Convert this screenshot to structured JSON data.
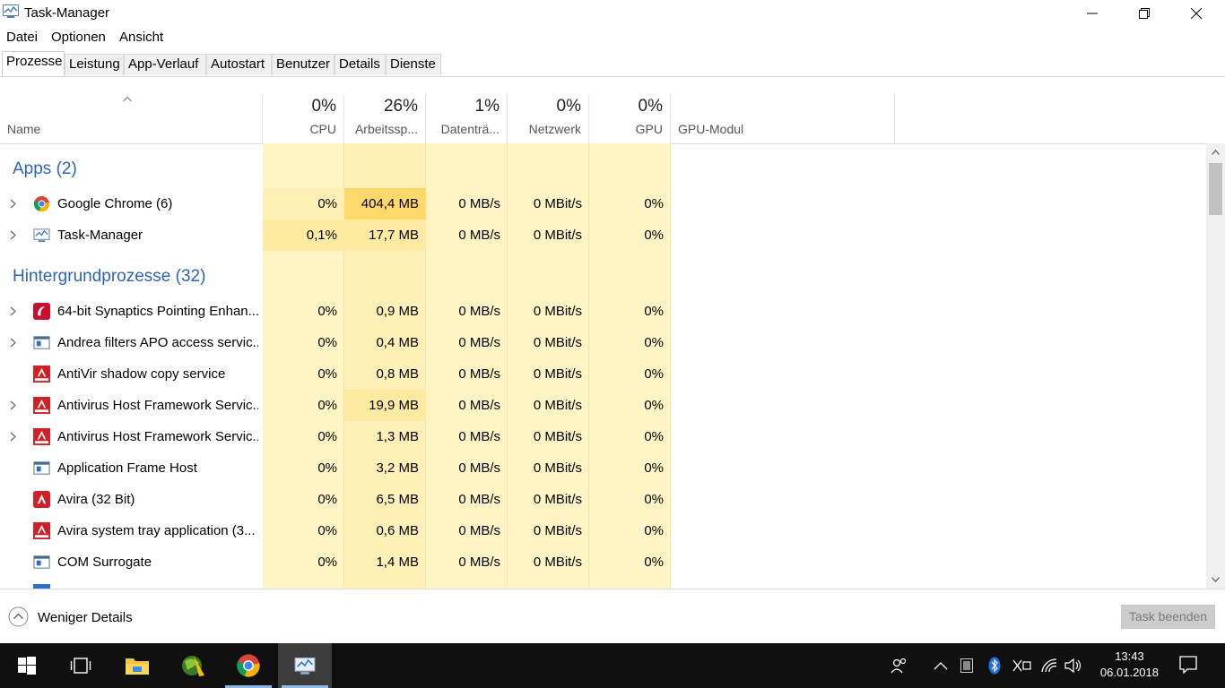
{
  "window": {
    "title": "Task-Manager"
  },
  "menu": [
    "Datei",
    "Optionen",
    "Ansicht"
  ],
  "tabs": [
    "Prozesse",
    "Leistung",
    "App-Verlauf",
    "Autostart",
    "Benutzer",
    "Details",
    "Dienste"
  ],
  "active_tab": "Prozesse",
  "columns": {
    "name": "Name",
    "cpu": {
      "pct": "0%",
      "label": "CPU"
    },
    "mem": {
      "pct": "26%",
      "label": "Arbeitssp..."
    },
    "disk": {
      "pct": "1%",
      "label": "Datenträ..."
    },
    "net": {
      "pct": "0%",
      "label": "Netzwerk"
    },
    "gpu": {
      "pct": "0%",
      "label": "GPU"
    },
    "gpu_engine": {
      "label": "GPU-Modul"
    }
  },
  "groups": {
    "apps": "Apps (2)",
    "background": "Hintergrundprozesse (32)"
  },
  "apps": [
    {
      "name": "Google Chrome (6)",
      "icon": "chrome-icon",
      "expandable": true,
      "cpu": "0%",
      "mem": "404,4 MB",
      "disk": "0 MB/s",
      "net": "0 MBit/s",
      "gpu": "0%"
    },
    {
      "name": "Task-Manager",
      "icon": "task-manager-icon",
      "expandable": true,
      "cpu": "0,1%",
      "mem": "17,7 MB",
      "disk": "0 MB/s",
      "net": "0 MBit/s",
      "gpu": "0%"
    }
  ],
  "background": [
    {
      "name": "64-bit Synaptics Pointing Enhan...",
      "icon": "synaptics-icon",
      "expandable": true,
      "cpu": "0%",
      "mem": "0,9 MB",
      "disk": "0 MB/s",
      "net": "0 MBit/s",
      "gpu": "0%"
    },
    {
      "name": "Andrea filters APO access servic...",
      "icon": "service-window-icon",
      "expandable": true,
      "cpu": "0%",
      "mem": "0,4 MB",
      "disk": "0 MB/s",
      "net": "0 MBit/s",
      "gpu": "0%"
    },
    {
      "name": "AntiVir shadow copy service",
      "icon": "avira-icon",
      "expandable": false,
      "cpu": "0%",
      "mem": "0,8 MB",
      "disk": "0 MB/s",
      "net": "0 MBit/s",
      "gpu": "0%"
    },
    {
      "name": "Antivirus Host Framework Servic...",
      "icon": "avira-icon",
      "expandable": true,
      "cpu": "0%",
      "mem": "19,9 MB",
      "disk": "0 MB/s",
      "net": "0 MBit/s",
      "gpu": "0%"
    },
    {
      "name": "Antivirus Host Framework Servic...",
      "icon": "avira-icon",
      "expandable": true,
      "cpu": "0%",
      "mem": "1,3 MB",
      "disk": "0 MB/s",
      "net": "0 MBit/s",
      "gpu": "0%"
    },
    {
      "name": "Application Frame Host",
      "icon": "service-window-icon",
      "expandable": false,
      "cpu": "0%",
      "mem": "3,2 MB",
      "disk": "0 MB/s",
      "net": "0 MBit/s",
      "gpu": "0%"
    },
    {
      "name": "Avira (32 Bit)",
      "icon": "avira-umbrella-icon",
      "expandable": false,
      "cpu": "0%",
      "mem": "6,5 MB",
      "disk": "0 MB/s",
      "net": "0 MBit/s",
      "gpu": "0%"
    },
    {
      "name": "Avira system tray application (3...",
      "icon": "avira-icon",
      "expandable": false,
      "cpu": "0%",
      "mem": "0,6 MB",
      "disk": "0 MB/s",
      "net": "0 MBit/s",
      "gpu": "0%"
    },
    {
      "name": "COM Surrogate",
      "icon": "service-window-icon",
      "expandable": false,
      "cpu": "0%",
      "mem": "1,4 MB",
      "disk": "0 MB/s",
      "net": "0 MBit/s",
      "gpu": "0%"
    }
  ],
  "footer": {
    "fewer_details": "Weniger Details",
    "end_task": "Task beenden"
  },
  "taskbar": {
    "time": "13:43",
    "date": "06.01.2018"
  },
  "colors": {
    "accent": "#2e64b4",
    "heat_light": "#fff4c4",
    "heat_mid": "#ffeaa1",
    "heat_high": "#ffd86b"
  }
}
